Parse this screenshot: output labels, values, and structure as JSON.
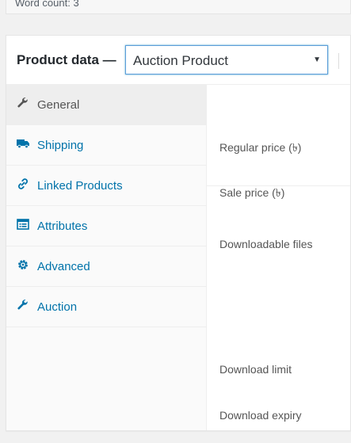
{
  "word_count": "Word count: 3",
  "header": {
    "title": "Product data —",
    "product_type": "Auction Product"
  },
  "tabs": [
    {
      "label": "General",
      "icon": "wrench-icon",
      "active": true
    },
    {
      "label": "Shipping",
      "icon": "truck-icon",
      "active": false
    },
    {
      "label": "Linked Products",
      "icon": "link-icon",
      "active": false
    },
    {
      "label": "Attributes",
      "icon": "list-icon",
      "active": false
    },
    {
      "label": "Advanced",
      "icon": "gear-icon",
      "active": false
    },
    {
      "label": "Auction",
      "icon": "wrench-icon",
      "active": false
    }
  ],
  "fields": {
    "regular_price": "Regular price (৳)",
    "sale_price": "Sale price (৳)",
    "downloadable_files": "Downloadable files",
    "download_limit": "Download limit",
    "download_expiry": "Download expiry"
  },
  "colors": {
    "link": "#0073aa",
    "focus_border": "#5b9dd9",
    "active_tab_bg": "#eeeeee"
  }
}
